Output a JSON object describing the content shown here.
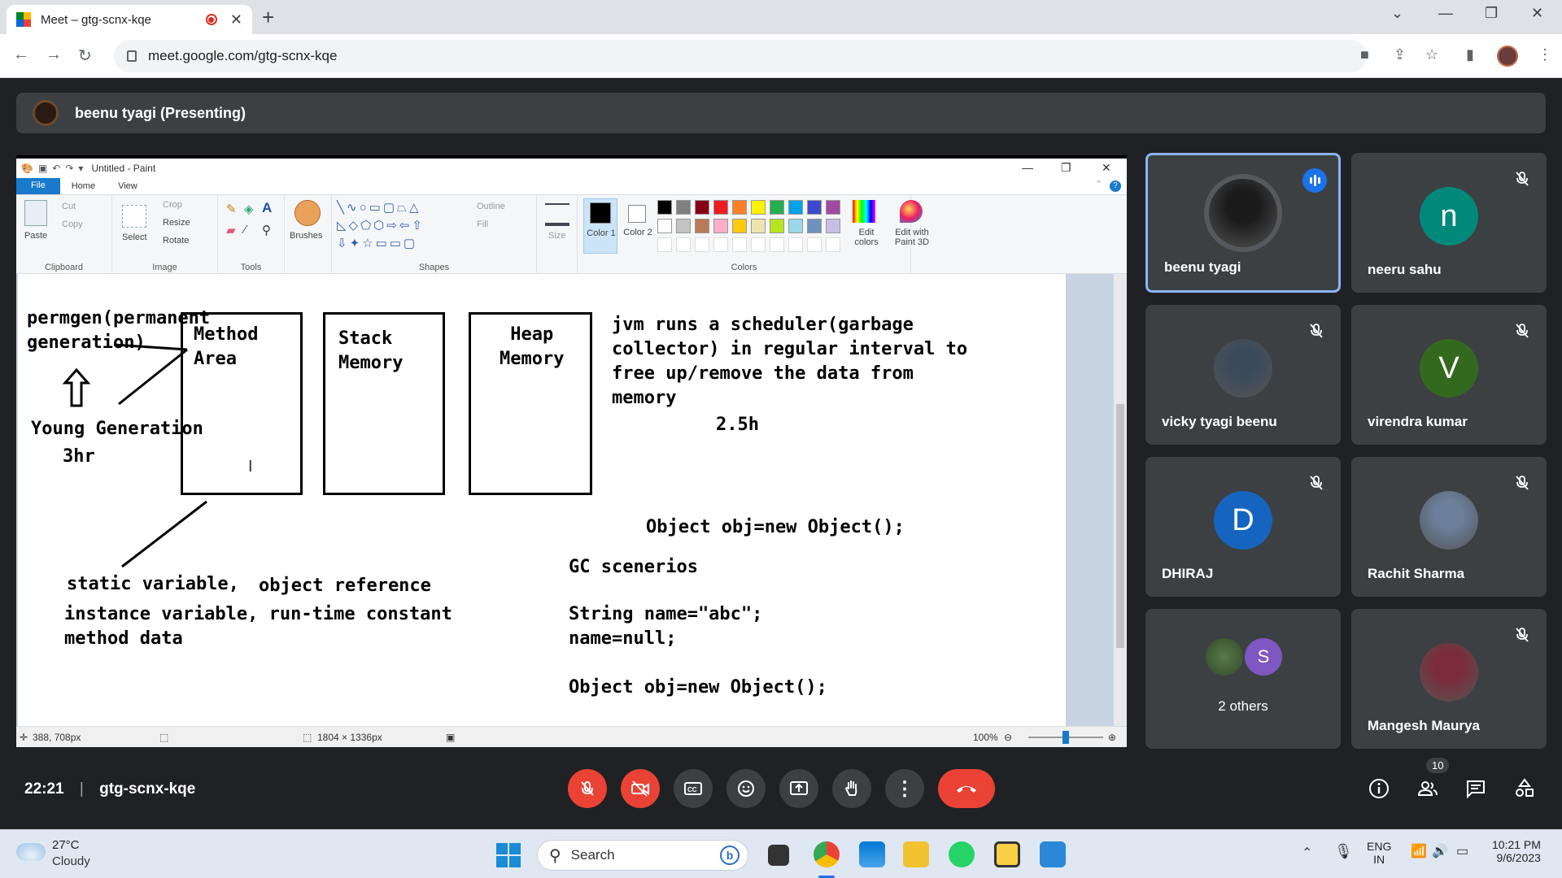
{
  "browser": {
    "tab_title": "Meet – gtg-scnx-kqe",
    "url": "meet.google.com/gtg-scnx-kqe",
    "new_tab": "+",
    "close_tab": "✕"
  },
  "presenter_bar": {
    "label": "beenu tyagi (Presenting)"
  },
  "paint": {
    "window_title": "Untitled - Paint",
    "tabs": [
      "File",
      "Home",
      "View"
    ],
    "clipboard": {
      "paste": "Paste",
      "cut": "Cut",
      "copy": "Copy",
      "group": "Clipboard"
    },
    "image": {
      "select": "Select",
      "crop": "Crop",
      "resize": "Resize",
      "rotate": "Rotate",
      "group": "Image"
    },
    "tools_group": "Tools",
    "brushes": "Brushes",
    "shapes": {
      "outline": "Outline",
      "fill": "Fill",
      "group": "Shapes"
    },
    "size": "Size",
    "color1": "Color 1",
    "color2": "Color 2",
    "colors_group": "Colors",
    "edit_colors": "Edit colors",
    "edit_paint3d": "Edit with Paint 3D",
    "palette_row1": [
      "#000000",
      "#7f7f7f",
      "#880015",
      "#ed1c24",
      "#ff7f27",
      "#fff200",
      "#22b14c",
      "#00a2e8",
      "#3f48cc",
      "#a349a4"
    ],
    "palette_row2": [
      "#ffffff",
      "#c3c3c3",
      "#b97a57",
      "#ffaec9",
      "#ffc90e",
      "#efe4b0",
      "#b5e61d",
      "#99d9ea",
      "#7092be",
      "#c8bfe7"
    ],
    "status": {
      "cursor_pos": "388, 708px",
      "canvas_size": "1804 × 1336px",
      "zoom": "100%"
    }
  },
  "canvas_text": {
    "permgen": "permgen(permanent\ngeneration)",
    "method_area": "Method\nArea",
    "stack_memory": "Stack\nMemory",
    "heap_memory": "Heap\nMemory",
    "jvm": "jvm runs a scheduler(garbage\ncollector) in regular interval to\nfree up/remove the data from\nmemory",
    "time_25": "2.5h",
    "young_gen": "Young Generation",
    "time_3": "3hr",
    "obj1": "Object obj=new Object();",
    "gc": "GC scenerios",
    "static_var": "static variable,",
    "obj_ref": "object reference",
    "instance_var": "instance variable, run-time constant\nmethod data",
    "string_name": "String name=\"abc\";\nname=null;",
    "obj2": "Object obj=new Object();"
  },
  "participants": [
    {
      "name": "beenu tyagi",
      "type": "photo",
      "color": "#1a1a1a",
      "speaking": true
    },
    {
      "name": "neeru sahu",
      "type": "initial",
      "initial": "n",
      "color": "#00897b"
    },
    {
      "name": "vicky tyagi beenu",
      "type": "photo",
      "color": "#3b4a5a"
    },
    {
      "name": "virendra kumar",
      "type": "initial",
      "initial": "V",
      "color": "#33691e"
    },
    {
      "name": "DHIRAJ",
      "type": "initial",
      "initial": "D",
      "color": "#1565c0"
    },
    {
      "name": "Rachit Sharma",
      "type": "photo",
      "color": "#6b7f9a"
    },
    {
      "name": "2 others",
      "type": "others",
      "initial": "S",
      "color": "#7e57c2"
    },
    {
      "name": "Mangesh Maurya",
      "type": "photo",
      "color": "#7a2c3a"
    }
  ],
  "meeting": {
    "time": "22:21",
    "code": "gtg-scnx-kqe",
    "people_count": "10"
  },
  "taskbar": {
    "temp": "27°C",
    "weather": "Cloudy",
    "search": "Search",
    "lang1": "ENG",
    "lang2": "IN",
    "time": "10:21 PM",
    "date": "9/6/2023"
  }
}
